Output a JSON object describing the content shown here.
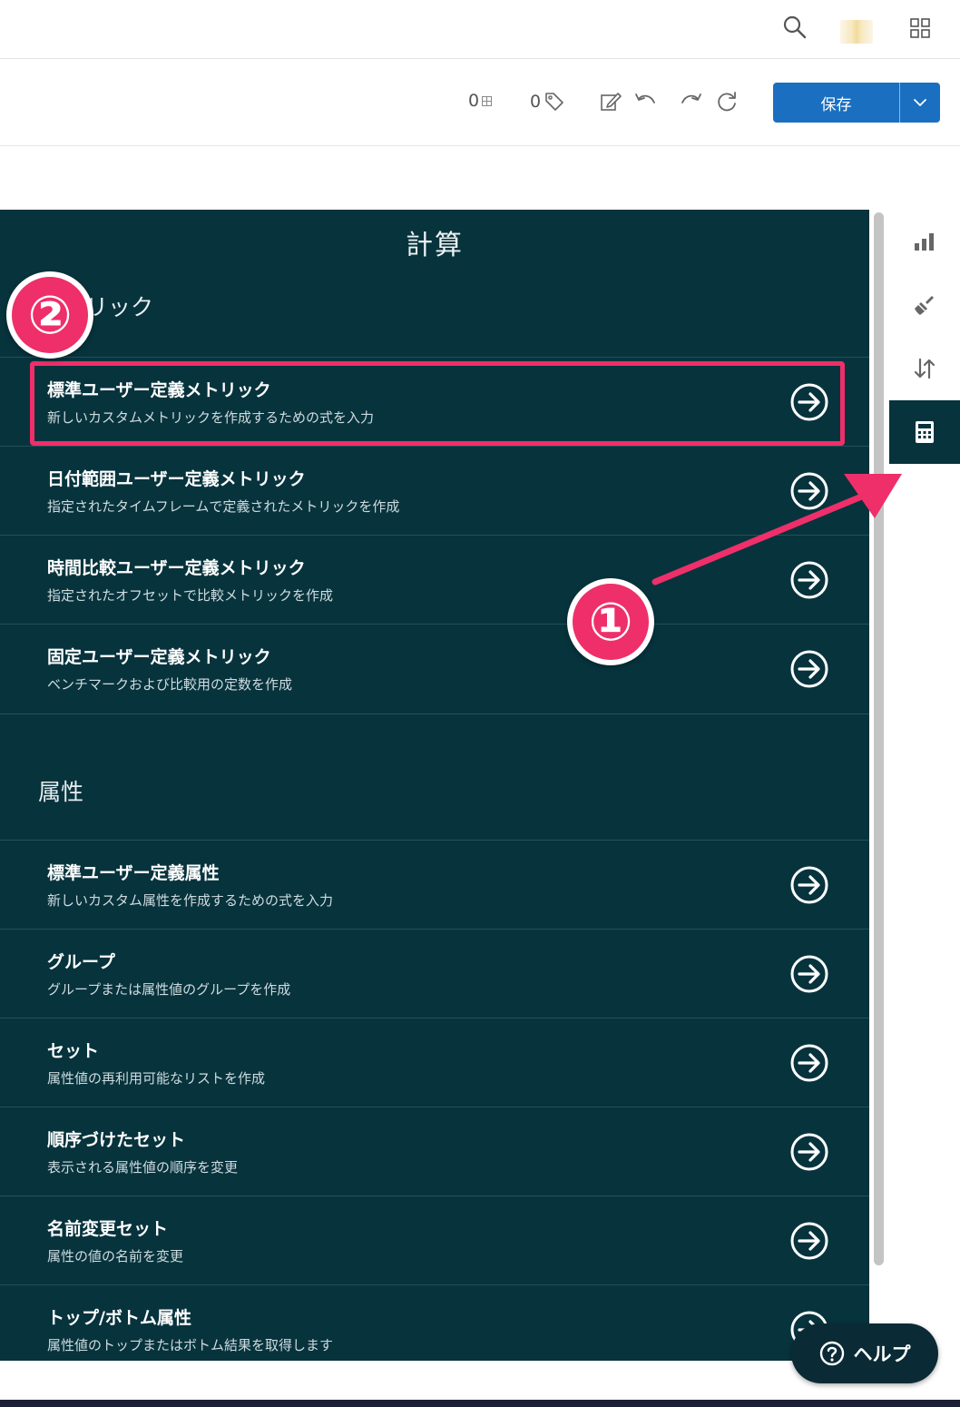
{
  "topbar": {
    "icons": [
      "search-icon",
      "avatar",
      "apps-grid-icon"
    ]
  },
  "toolbar": {
    "metric_count": "0",
    "tag_count": "0",
    "save_label": "保存",
    "icons": [
      "table-icon",
      "tag-icon",
      "edit-icon",
      "undo-icon",
      "redo-icon",
      "refresh-icon",
      "chevron-down-icon"
    ]
  },
  "panel": {
    "title": "計算",
    "sections": [
      {
        "heading": "リック",
        "items": [
          {
            "title": "標準ユーザー定義メトリック",
            "desc": "新しいカスタムメトリックを作成するための式を入力"
          },
          {
            "title": "日付範囲ユーザー定義メトリック",
            "desc": "指定されたタイムフレームで定義されたメトリックを作成"
          },
          {
            "title": "時間比較ユーザー定義メトリック",
            "desc": "指定されたオフセットで比較メトリックを作成"
          },
          {
            "title": "固定ユーザー定義メトリック",
            "desc": "ベンチマークおよび比較用の定数を作成"
          }
        ]
      },
      {
        "heading": "属性",
        "items": [
          {
            "title": "標準ユーザー定義属性",
            "desc": "新しいカスタム属性を作成するための式を入力"
          },
          {
            "title": "グループ",
            "desc": "グループまたは属性値のグループを作成"
          },
          {
            "title": "セット",
            "desc": "属性値の再利用可能なリストを作成"
          },
          {
            "title": "順序づけたセット",
            "desc": "表示される属性値の順序を変更"
          },
          {
            "title": "名前変更セット",
            "desc": "属性の値の名前を変更"
          },
          {
            "title": "トップ/ボトム属性",
            "desc": "属性値のトップまたはボトム結果を取得します"
          }
        ]
      }
    ]
  },
  "rail": {
    "items": [
      "bar-chart-icon",
      "brush-icon",
      "sort-icon",
      "calculator-icon"
    ],
    "active": "calculator-icon"
  },
  "help": {
    "label": "ヘルプ"
  },
  "annotations": {
    "badge1": "①",
    "badge2": "②",
    "accent_color": "#ee2f6a"
  },
  "colors": {
    "panel_bg": "#07333d",
    "save_button": "#1a6fc0"
  }
}
